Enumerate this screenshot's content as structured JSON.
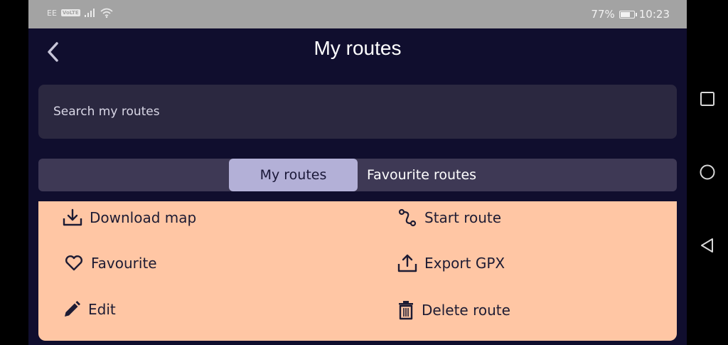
{
  "status_bar": {
    "carrier": "EE",
    "volte": "VoLTE",
    "battery": "77%",
    "battery_level": 0.77,
    "time": "10:23"
  },
  "header": {
    "title": "My routes",
    "back_icon": "chevron-left-icon"
  },
  "search": {
    "placeholder": "Search my routes",
    "value": ""
  },
  "tabs": [
    {
      "label": "My routes",
      "active": true
    },
    {
      "label": "Favourite routes",
      "active": false
    }
  ],
  "actions": [
    {
      "label": "Download map",
      "icon": "download-icon"
    },
    {
      "label": "Start route",
      "icon": "route-icon"
    },
    {
      "label": "Favourite",
      "icon": "heart-icon"
    },
    {
      "label": "Export GPX",
      "icon": "export-icon"
    },
    {
      "label": "Edit",
      "icon": "pencil-icon"
    },
    {
      "label": "Delete route",
      "icon": "trash-icon"
    }
  ],
  "nav": {
    "icons": [
      "recent-apps-icon",
      "home-icon",
      "back-icon"
    ]
  },
  "colors": {
    "background": "#100e2e",
    "search_bg": "#2b2840",
    "tab_bar_bg": "#3e3955",
    "tab_active_bg": "#b3b0d7",
    "panel_bg": "#ffc6a4",
    "status_bar_bg": "#a3a3a3"
  }
}
